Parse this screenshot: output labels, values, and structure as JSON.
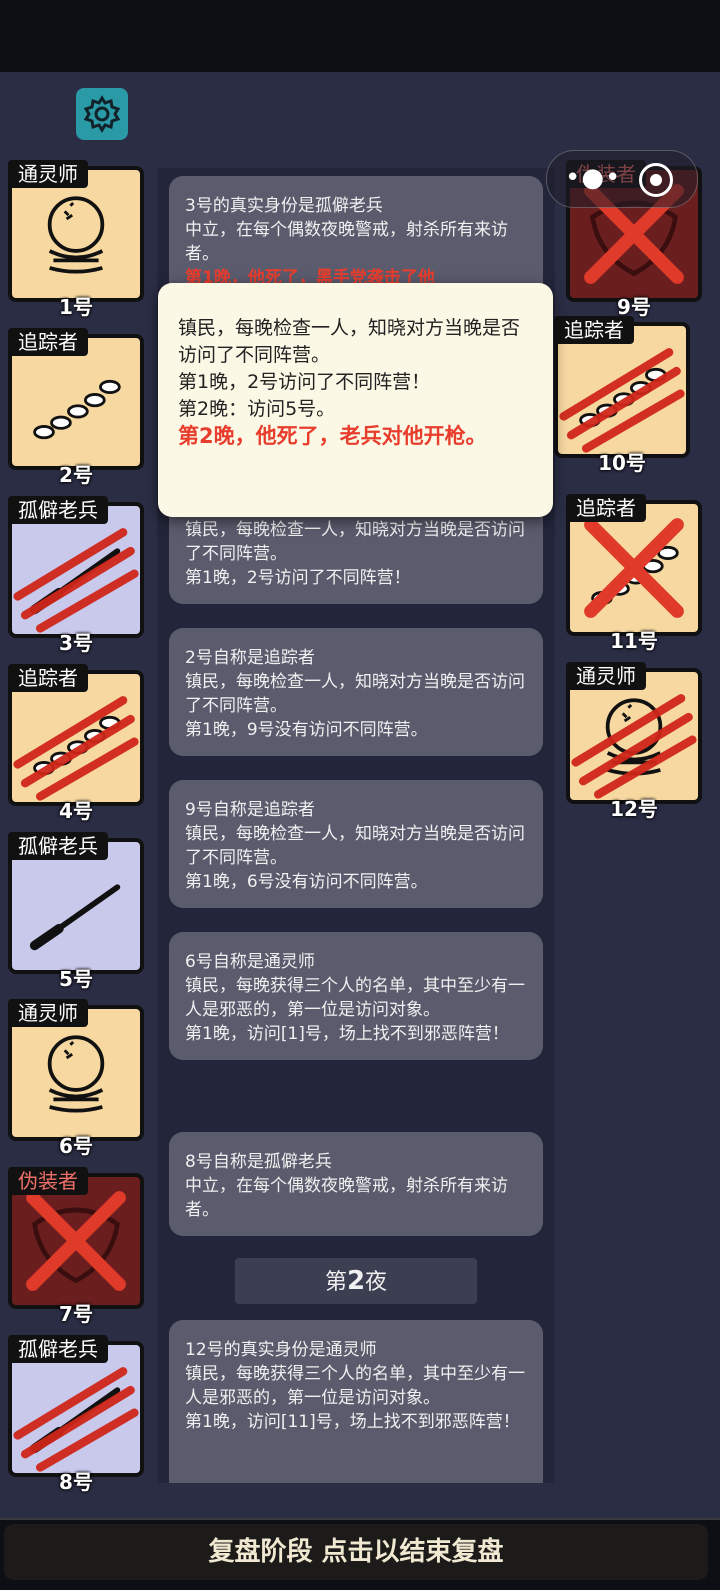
{
  "footer": {
    "label": "复盘阶段 点击以结束复盘"
  },
  "icons": {
    "settings": "gear-icon",
    "more": "more-dots-icon",
    "close": "close-circle-icon"
  },
  "players": [
    {
      "num": "1号",
      "role": "通灵师",
      "type": "seer",
      "side": "left",
      "status": "alive"
    },
    {
      "num": "2号",
      "role": "追踪者",
      "type": "tracker",
      "side": "left",
      "status": "alive"
    },
    {
      "num": "3号",
      "role": "孤僻老兵",
      "type": "veteran",
      "side": "left",
      "status": "slashed"
    },
    {
      "num": "4号",
      "role": "追踪者",
      "type": "tracker",
      "side": "left",
      "status": "slashed"
    },
    {
      "num": "5号",
      "role": "孤僻老兵",
      "type": "veteran",
      "side": "left",
      "status": "alive"
    },
    {
      "num": "6号",
      "role": "通灵师",
      "type": "seer",
      "side": "left",
      "status": "alive"
    },
    {
      "num": "7号",
      "role": "伪装者",
      "type": "disguiser",
      "side": "left",
      "status": "crossed"
    },
    {
      "num": "8号",
      "role": "孤僻老兵",
      "type": "veteran",
      "side": "left",
      "status": "slashed"
    },
    {
      "num": "9号",
      "role": "伪装者",
      "type": "disguiser",
      "side": "right",
      "status": "crossed"
    },
    {
      "num": "10号",
      "role": "追踪者",
      "type": "tracker",
      "side": "right",
      "status": "slashed"
    },
    {
      "num": "11号",
      "role": "追踪者",
      "type": "tracker",
      "side": "right",
      "status": "crossed"
    },
    {
      "num": "12号",
      "role": "通灵师",
      "type": "seer",
      "side": "right",
      "status": "slashed"
    }
  ],
  "feed": {
    "card1": {
      "title": "3号的真实身份是孤僻老兵",
      "line1": "中立，在每个偶数夜晚警戒，射杀所有来访者。",
      "red": "第1晚，他死了，黑手党袭击了他"
    },
    "card2": {
      "line1": "镇民，每晚检查一人，知晓对方当晚是否访问了不同阵营。",
      "line2": "第1晚，2号访问了不同阵营！"
    },
    "card3": {
      "title": "2号自称是追踪者",
      "line1": "镇民，每晚检查一人，知晓对方当晚是否访问了不同阵营。",
      "line2": "第1晚，9号没有访问不同阵营。"
    },
    "card4": {
      "title": "9号自称是追踪者",
      "line1": "镇民，每晚检查一人，知晓对方当晚是否访问了不同阵营。",
      "line2": "第1晚，6号没有访问不同阵营。"
    },
    "card5": {
      "title": "6号自称是通灵师",
      "line1": "镇民，每晚获得三个人的名单，其中至少有一人是邪恶的，第一位是访问对象。",
      "line2": "第1晚，访问[1]号，场上找不到邪恶阵营！"
    },
    "card6": {
      "title": "8号自称是孤僻老兵",
      "line1": "中立，在每个偶数夜晚警戒，射杀所有来访者。"
    },
    "night": {
      "prefix": "第",
      "num": "2",
      "suffix": "夜"
    },
    "card7": {
      "title": "12号的真实身份是通灵师",
      "line1": "镇民，每晚获得三个人的名单，其中至少有一人是邪恶的，第一位是访问对象。",
      "line2": "第1晚，访问[11]号，场上找不到邪恶阵营！"
    }
  },
  "popup": {
    "line1": "镇民，每晚检查一人，知晓对方当晚是否访问了不同阵营。",
    "line2": "第1晚，2号访问了不同阵营！",
    "line3": "第2晚：访问5号。",
    "red": "第2晚，他死了，老兵对他开枪。"
  }
}
